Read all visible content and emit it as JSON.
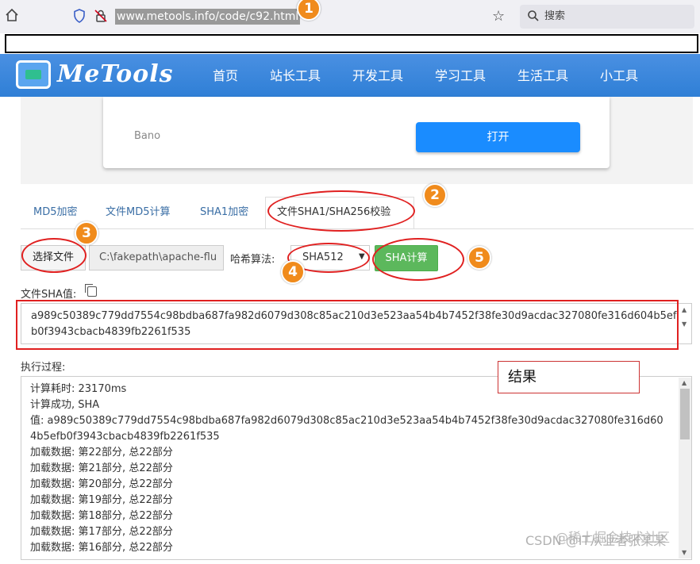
{
  "browser": {
    "url": "www.metools.info/code/c92.html",
    "search_label": "搜索"
  },
  "nav": {
    "logo": "MeTools",
    "items": [
      "首页",
      "站长工具",
      "开发工具",
      "学习工具",
      "生活工具",
      "小工具"
    ]
  },
  "ad": {
    "brand": "Bano",
    "open_label": "打开"
  },
  "tabs": [
    "MD5加密",
    "文件MD5计算",
    "SHA1加密",
    "文件SHA1/SHA256校验"
  ],
  "controls": {
    "choose_file": "选择文件",
    "file_path": "C:\\fakepath\\apache-flu",
    "algo_label": "哈希算法:",
    "algo_value": "SHA512",
    "compute": "SHA计算"
  },
  "sha": {
    "title": "文件SHA值:",
    "value": "a989c50389c779dd7554c98bdba687fa982d6079d308c85ac210d3e523aa54b4b7452f38fe30d9acdac327080fe316d604b5efb0f3943cbacb4839fb2261f535"
  },
  "process": {
    "title": "执行过程:",
    "lines": [
      "计算耗时: 23170ms",
      "计算成功, SHA",
      "值: a989c50389c779dd7554c98bdba687fa982d6079d308c85ac210d3e523aa54b4b7452f38fe30d9acdac327080fe316d604b5efb0f3943cbacb4839fb2261f535",
      "加载数据: 第22部分, 总22部分",
      "加载数据: 第21部分, 总22部分",
      "加载数据: 第20部分, 总22部分",
      "加载数据: 第19部分, 总22部分",
      "加载数据: 第18部分, 总22部分",
      "加载数据: 第17部分, 总22部分",
      "加载数据: 第16部分, 总22部分"
    ]
  },
  "annotations": {
    "badges": [
      "1",
      "2",
      "3",
      "4",
      "5"
    ],
    "result_label": "结果",
    "color": "#e02020",
    "badge_color": "#f08b1c"
  },
  "watermark": "CSDN @IT从业者张某某",
  "watermark_overlay": "@稀土掘金技术社区"
}
